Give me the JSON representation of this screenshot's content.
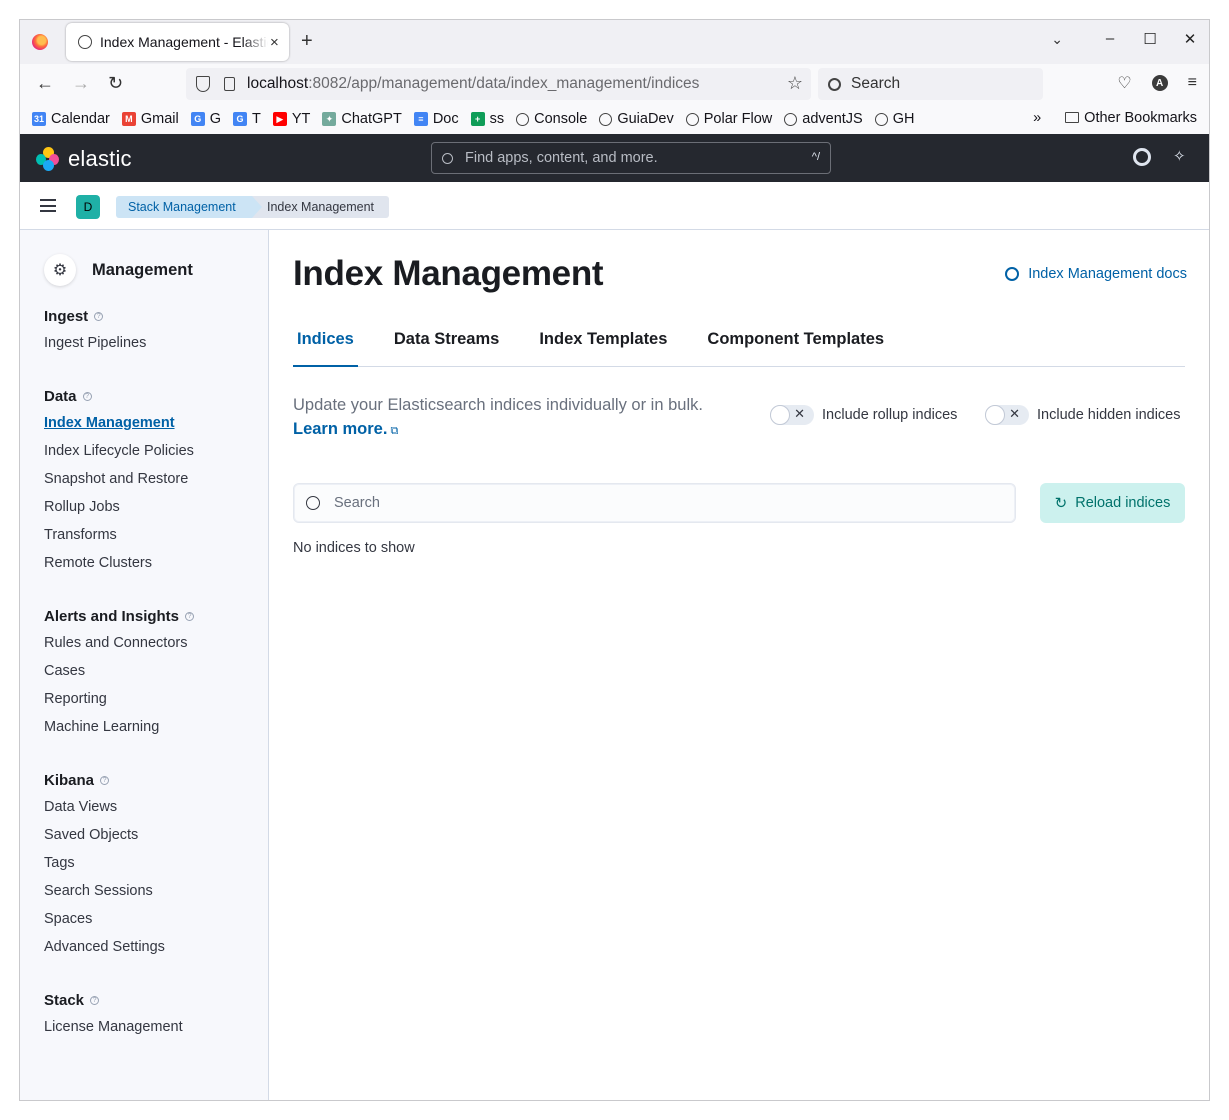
{
  "browser": {
    "tab_title": "Index Management - Elastic",
    "tab_close": "×",
    "new_tab": "+",
    "url_host": "localhost",
    "url_path": ":8082/app/management/data/index_management/indices",
    "search_placeholder": "Search",
    "bookmarks": [
      {
        "label": "Calendar",
        "icon": "calendar-icon",
        "color": "#4285f4",
        "glyph": "31"
      },
      {
        "label": "Gmail",
        "icon": "gmail-icon",
        "color": "#ea4335",
        "glyph": "M"
      },
      {
        "label": "G",
        "icon": "google-icon",
        "color": "#4285f4",
        "glyph": "G"
      },
      {
        "label": "T",
        "icon": "translate-icon",
        "color": "#4285f4",
        "glyph": "G"
      },
      {
        "label": "YT",
        "icon": "youtube-icon",
        "color": "#ff0000",
        "glyph": "▶"
      },
      {
        "label": "ChatGPT",
        "icon": "chatgpt-icon",
        "color": "#74aa9c",
        "glyph": "✦"
      },
      {
        "label": "Doc",
        "icon": "docs-icon",
        "color": "#4285f4",
        "glyph": "≡"
      },
      {
        "label": "ss",
        "icon": "sheets-icon",
        "color": "#0f9d58",
        "glyph": "+"
      },
      {
        "label": "Console",
        "icon": "globe-icon"
      },
      {
        "label": "GuiaDev",
        "icon": "globe-icon"
      },
      {
        "label": "Polar Flow",
        "icon": "globe-icon"
      },
      {
        "label": "adventJS",
        "icon": "globe-icon"
      },
      {
        "label": "GH",
        "icon": "github-icon"
      }
    ],
    "other_bookmarks": "Other Bookmarks",
    "overflow": "»"
  },
  "kibana": {
    "brand": "elastic",
    "global_search_placeholder": "Find apps, content, and more.",
    "global_search_shortcut": "^/",
    "space_initial": "D",
    "breadcrumbs": [
      "Stack Management",
      "Index Management"
    ]
  },
  "sidebar": {
    "title": "Management",
    "groups": [
      {
        "title": "Ingest",
        "items": [
          "Ingest Pipelines"
        ]
      },
      {
        "title": "Data",
        "items": [
          "Index Management",
          "Index Lifecycle Policies",
          "Snapshot and Restore",
          "Rollup Jobs",
          "Transforms",
          "Remote Clusters"
        ]
      },
      {
        "title": "Alerts and Insights",
        "items": [
          "Rules and Connectors",
          "Cases",
          "Reporting",
          "Machine Learning"
        ]
      },
      {
        "title": "Kibana",
        "items": [
          "Data Views",
          "Saved Objects",
          "Tags",
          "Search Sessions",
          "Spaces",
          "Advanced Settings"
        ]
      },
      {
        "title": "Stack",
        "items": [
          "License Management"
        ]
      }
    ],
    "active_item": "Index Management"
  },
  "main": {
    "title": "Index Management",
    "docs_link": "Index Management docs",
    "tabs": [
      "Indices",
      "Data Streams",
      "Index Templates",
      "Component Templates"
    ],
    "selected_tab": "Indices",
    "description": "Update your Elasticsearch indices individually or in bulk.",
    "learn_more": "Learn more.",
    "toggle_rollup": "Include rollup indices",
    "toggle_hidden": "Include hidden indices",
    "search_placeholder": "Search",
    "reload_button": "Reload indices",
    "empty_message": "No indices to show"
  },
  "colors": {
    "accent": "#0061a6",
    "header_bg": "#25282f",
    "reload_bg": "#ccf1ee",
    "space_badge": "#1fb0a6"
  }
}
